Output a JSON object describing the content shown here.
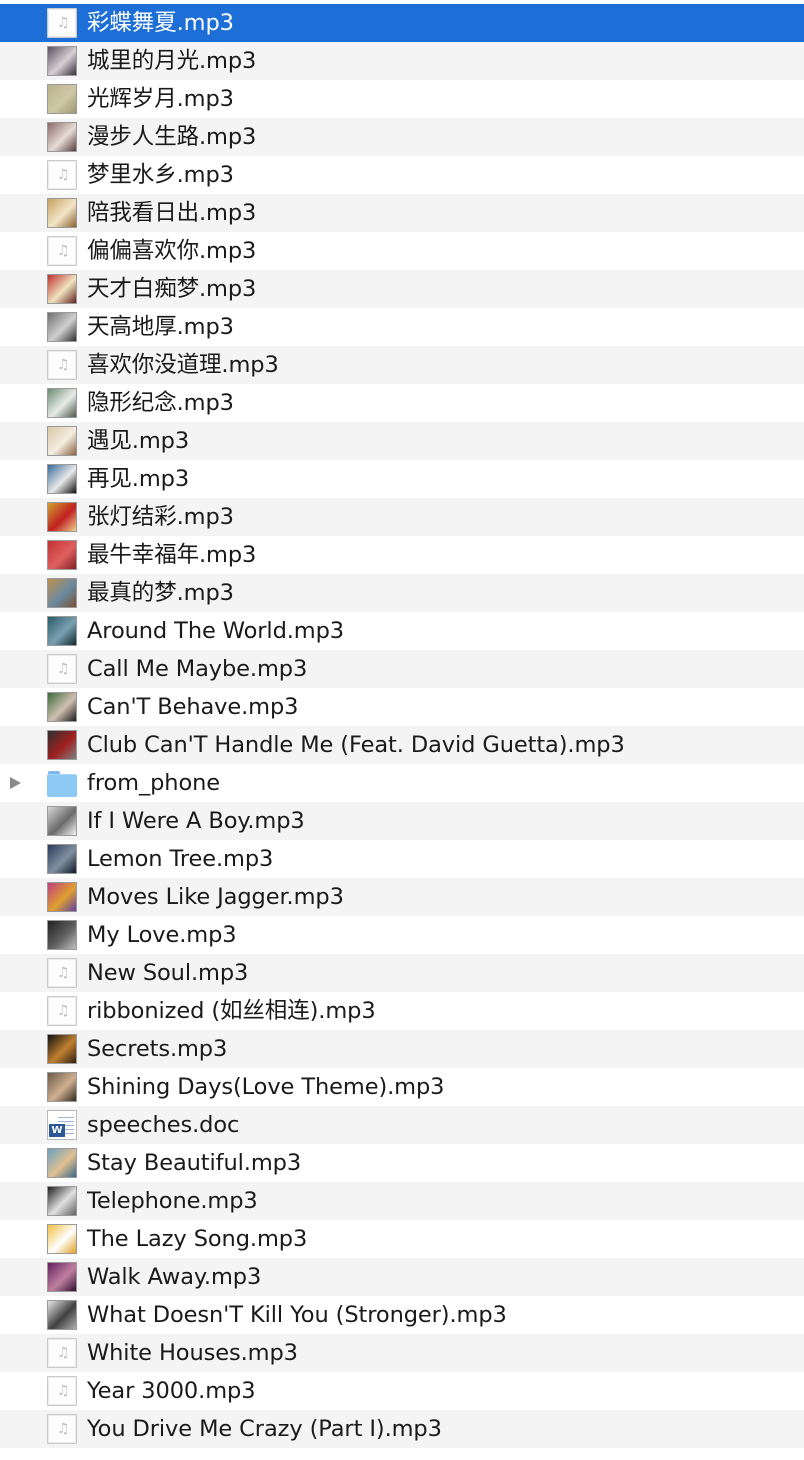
{
  "files": [
    {
      "name": "彩蝶舞夏.mp3",
      "icon": "music-file-icon",
      "selected": true
    },
    {
      "name": "城里的月光.mp3",
      "icon": "album-art-icon",
      "colors": [
        "#5a5060",
        "#d8cfd4",
        "#3a3040"
      ]
    },
    {
      "name": "光辉岁月.mp3",
      "icon": "album-art-icon",
      "colors": [
        "#b8b08a",
        "#cfc9a6",
        "#9e9670"
      ]
    },
    {
      "name": "漫步人生路.mp3",
      "icon": "album-art-icon",
      "colors": [
        "#8a6a6a",
        "#e6dcd6",
        "#553c3c"
      ]
    },
    {
      "name": "梦里水乡.mp3",
      "icon": "music-file-icon"
    },
    {
      "name": "陪我看日出.mp3",
      "icon": "album-art-icon",
      "colors": [
        "#c9a060",
        "#f3e6c8",
        "#8a6030"
      ]
    },
    {
      "name": "偏偏喜欢你.mp3",
      "icon": "music-file-icon"
    },
    {
      "name": "天才白痴梦.mp3",
      "icon": "album-art-icon",
      "colors": [
        "#c03030",
        "#f0e4c0",
        "#602020"
      ]
    },
    {
      "name": "天高地厚.mp3",
      "icon": "album-art-icon",
      "colors": [
        "#707070",
        "#d0d0d0",
        "#303030"
      ]
    },
    {
      "name": "喜欢你没道理.mp3",
      "icon": "music-file-icon"
    },
    {
      "name": "隐形纪念.mp3",
      "icon": "album-art-icon",
      "colors": [
        "#6a8a70",
        "#e8ece8",
        "#4a5a4c"
      ]
    },
    {
      "name": "遇见.mp3",
      "icon": "album-art-icon",
      "colors": [
        "#d9c8a8",
        "#f4ede0",
        "#8a6040"
      ]
    },
    {
      "name": "再见.mp3",
      "icon": "album-art-icon",
      "colors": [
        "#3a6a9a",
        "#e8e8e8",
        "#101010"
      ]
    },
    {
      "name": "张灯结彩.mp3",
      "icon": "album-art-icon",
      "colors": [
        "#d0a030",
        "#c02020",
        "#f0d090"
      ]
    },
    {
      "name": "最牛幸福年.mp3",
      "icon": "album-art-icon",
      "colors": [
        "#c03030",
        "#e06060",
        "#802020"
      ]
    },
    {
      "name": "最真的梦.mp3",
      "icon": "album-art-icon",
      "colors": [
        "#c09050",
        "#6a8aa0",
        "#7a5030"
      ]
    },
    {
      "name": "Around The World.mp3",
      "icon": "album-art-icon",
      "colors": [
        "#2a5a6a",
        "#7aa0b0",
        "#102830"
      ]
    },
    {
      "name": "Call Me Maybe.mp3",
      "icon": "music-file-icon"
    },
    {
      "name": "Can'T Behave.mp3",
      "icon": "album-art-icon",
      "colors": [
        "#3a6a3a",
        "#d0c0b0",
        "#1a1a1a"
      ]
    },
    {
      "name": "Club Can'T Handle Me (Feat. David Guetta).mp3",
      "icon": "album-art-icon",
      "colors": [
        "#303030",
        "#a02020",
        "#808080"
      ]
    },
    {
      "name": "from_phone",
      "icon": "folder-icon",
      "disclosure": true
    },
    {
      "name": "If I Were A Boy.mp3",
      "icon": "album-art-icon",
      "colors": [
        "#d8d8d8",
        "#6a6a6a",
        "#f4f4f4"
      ]
    },
    {
      "name": "Lemon Tree.mp3",
      "icon": "album-art-icon",
      "colors": [
        "#2a3a5a",
        "#8090a0",
        "#101828"
      ]
    },
    {
      "name": "Moves Like Jagger.mp3",
      "icon": "album-art-icon",
      "colors": [
        "#c04080",
        "#e0a030",
        "#6040a0"
      ]
    },
    {
      "name": "My Love.mp3",
      "icon": "album-art-icon",
      "colors": [
        "#202020",
        "#606060",
        "#c0c0c0"
      ]
    },
    {
      "name": "New Soul.mp3",
      "icon": "music-file-icon"
    },
    {
      "name": "ribbonized (如丝相连).mp3",
      "icon": "music-file-icon"
    },
    {
      "name": "Secrets.mp3",
      "icon": "album-art-icon",
      "colors": [
        "#101010",
        "#c08030",
        "#302010"
      ]
    },
    {
      "name": "Shining Days(Love Theme).mp3",
      "icon": "album-art-icon",
      "colors": [
        "#6a5a4a",
        "#d0b090",
        "#302820"
      ]
    },
    {
      "name": "speeches.doc",
      "icon": "word-doc-icon"
    },
    {
      "name": "Stay Beautiful.mp3",
      "icon": "album-art-icon",
      "colors": [
        "#6aa0c0",
        "#e0c090",
        "#3a6a8a"
      ]
    },
    {
      "name": "Telephone.mp3",
      "icon": "album-art-icon",
      "colors": [
        "#202020",
        "#e0e0e0",
        "#606060"
      ]
    },
    {
      "name": "The Lazy Song.mp3",
      "icon": "album-art-icon",
      "colors": [
        "#f0c040",
        "#ffffff",
        "#e0a020"
      ]
    },
    {
      "name": "Walk Away.mp3",
      "icon": "album-art-icon",
      "colors": [
        "#602060",
        "#c080a0",
        "#301030"
      ]
    },
    {
      "name": "What Doesn'T Kill You (Stronger).mp3",
      "icon": "album-art-icon",
      "colors": [
        "#e8e8e8",
        "#404040",
        "#b0b0b0"
      ]
    },
    {
      "name": "White Houses.mp3",
      "icon": "music-file-icon"
    },
    {
      "name": "Year 3000.mp3",
      "icon": "music-file-icon"
    },
    {
      "name": "You Drive Me Crazy (Part I).mp3",
      "icon": "music-file-icon"
    }
  ],
  "colors": {
    "selection": "#1d6fd7",
    "row_alt": "#f4f4f4",
    "folder": "#8ec8f5"
  }
}
